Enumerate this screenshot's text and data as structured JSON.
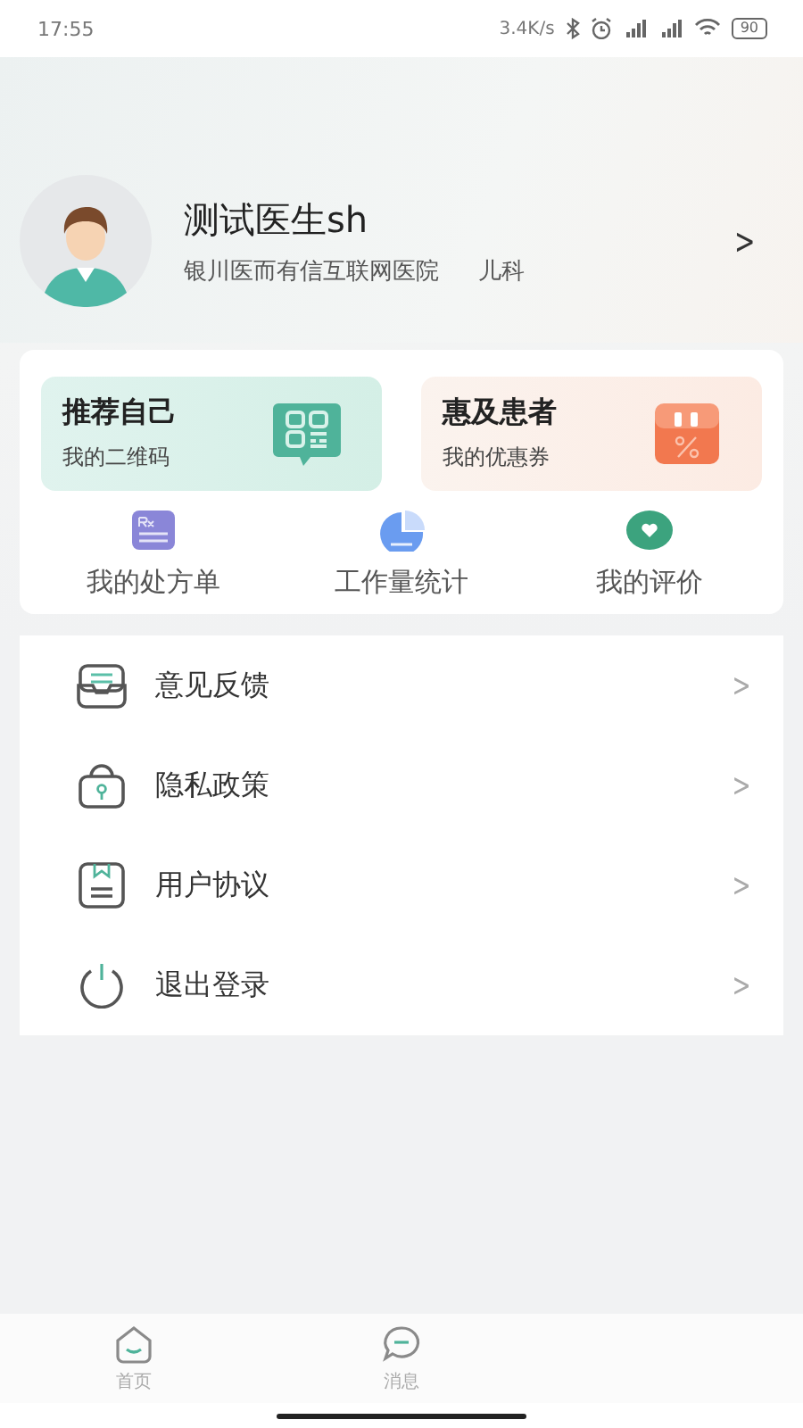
{
  "status_bar": {
    "time": "17:55",
    "speed": "3.4K/s",
    "battery": "90"
  },
  "profile": {
    "name": "测试医生sh",
    "hospital": "银川医而有信互联网医院",
    "department": "儿科",
    "chevron": ">"
  },
  "promo_cards": [
    {
      "kind": "qr",
      "title": "推荐自己",
      "subtitle": "我的二维码"
    },
    {
      "kind": "coupon",
      "title": "惠及患者",
      "subtitle": "我的优惠券"
    }
  ],
  "shortcuts": [
    {
      "kind": "prescription",
      "label": "我的处方单"
    },
    {
      "kind": "stats",
      "label": "工作量统计"
    },
    {
      "kind": "review",
      "label": "我的评价"
    }
  ],
  "menu": [
    {
      "kind": "feedback",
      "label": "意见反馈",
      "chevron": ">"
    },
    {
      "kind": "privacy",
      "label": "隐私政策",
      "chevron": ">"
    },
    {
      "kind": "agreement",
      "label": "用户协议",
      "chevron": ">"
    },
    {
      "kind": "logout",
      "label": "退出登录",
      "chevron": ">"
    }
  ],
  "tab_bar": [
    {
      "kind": "home",
      "label": "首页"
    },
    {
      "kind": "message",
      "label": "消息"
    }
  ]
}
